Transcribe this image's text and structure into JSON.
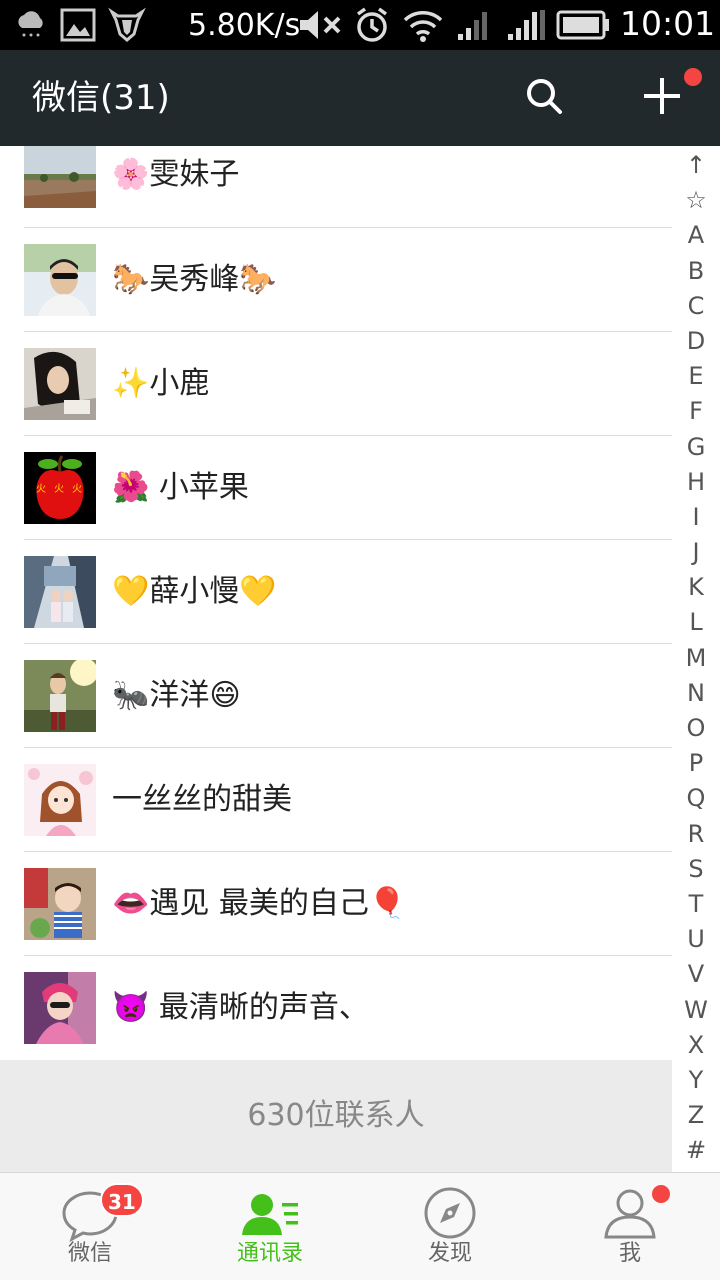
{
  "status_bar": {
    "speed": "5.80K/s",
    "time": "10:01",
    "icons": [
      "cloud-rain-icon",
      "image-icon",
      "shield-icon",
      "mute-icon",
      "alarm-icon",
      "wifi-icon",
      "signal-icon",
      "signal-icon",
      "battery-icon"
    ]
  },
  "header": {
    "title": "微信(31)",
    "search_icon": "search-icon",
    "add_icon": "plus-icon",
    "bg_color": "#22292c",
    "dot_color": "#f54542"
  },
  "contacts": [
    {
      "name": "🌸雯妹子"
    },
    {
      "name": "🐎吴秀峰🐎"
    },
    {
      "name": "✨小鹿"
    },
    {
      "name": "🌺 小苹果"
    },
    {
      "name": "💛薛小慢💛"
    },
    {
      "name": "🐜洋洋😄"
    },
    {
      "name": " 一丝丝的甜美"
    },
    {
      "name": "👄遇见 最美的自己🎈"
    },
    {
      "name": "👿 最清晰的声音、"
    }
  ],
  "index_letters": [
    "↑",
    "☆",
    "A",
    "B",
    "C",
    "D",
    "E",
    "F",
    "G",
    "H",
    "I",
    "J",
    "K",
    "L",
    "M",
    "N",
    "O",
    "P",
    "Q",
    "R",
    "S",
    "T",
    "U",
    "V",
    "W",
    "X",
    "Y",
    "Z",
    "#"
  ],
  "footer": {
    "count_text": "630位联系人"
  },
  "bottom_nav": {
    "active_color": "#45c01a",
    "items": [
      {
        "label": "微信",
        "icon": "chat-bubble-icon",
        "badge": "31"
      },
      {
        "label": "通讯录",
        "icon": "contacts-icon"
      },
      {
        "label": "发现",
        "icon": "compass-icon"
      },
      {
        "label": "我",
        "icon": "profile-icon"
      }
    ]
  }
}
